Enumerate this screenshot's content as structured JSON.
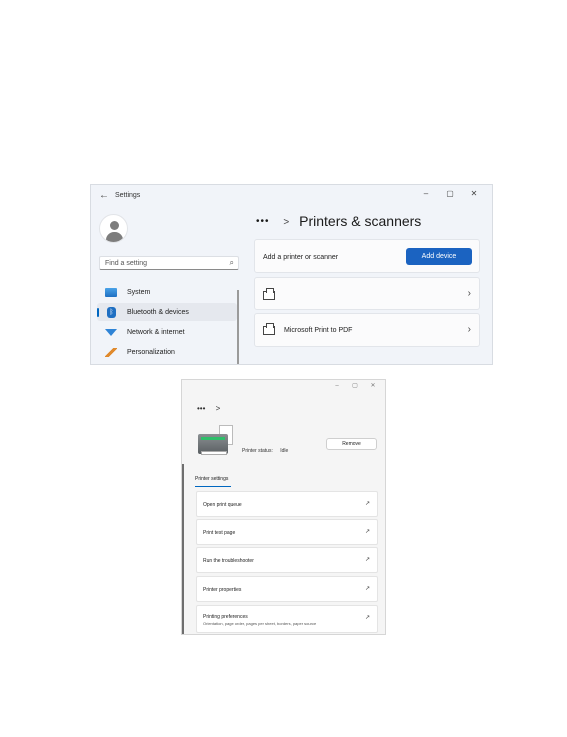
{
  "settings_window": {
    "app_title": "Settings",
    "back_icon": "←",
    "window_controls": {
      "minimize": "–",
      "maximize": "▢",
      "close": "✕"
    },
    "search": {
      "placeholder": "Find a setting",
      "icon": "⌕"
    },
    "nav_items": [
      {
        "label": "System",
        "icon": "monitor-icon",
        "active": false
      },
      {
        "label": "Bluetooth & devices",
        "icon": "bluetooth-icon",
        "active": true
      },
      {
        "label": "Network & internet",
        "icon": "wifi-icon",
        "active": false
      },
      {
        "label": "Personalization",
        "icon": "brush-icon",
        "active": false
      }
    ],
    "breadcrumb": {
      "dots": "•••",
      "separator": ">",
      "title": "Printers & scanners"
    },
    "add_card": {
      "label": "Add a printer or scanner",
      "button_label": "Add device"
    },
    "printers": [
      {
        "name": "",
        "chevron": "›"
      },
      {
        "name": "Microsoft Print to PDF",
        "chevron": "›"
      }
    ]
  },
  "printer_window": {
    "window_controls": {
      "minimize": "–",
      "maximize": "▢",
      "close": "✕"
    },
    "breadcrumb": {
      "dots": "•••",
      "separator": ">"
    },
    "status_label": "Printer status:",
    "status_value": "Idle",
    "remove_label": "Remove",
    "section_tab": "Printer settings",
    "rows": [
      {
        "label": "Open print queue",
        "sublabel": "",
        "icon": "↗"
      },
      {
        "label": "Print test page",
        "sublabel": "",
        "icon": "↗"
      },
      {
        "label": "Run the troubleshooter",
        "sublabel": "",
        "icon": "↗"
      },
      {
        "label": "Printer properties",
        "sublabel": "",
        "icon": "↗"
      },
      {
        "label": "Printing preferences",
        "sublabel": "Orientation, page order, pages per sheet, borders, paper source",
        "icon": "↗"
      }
    ]
  }
}
